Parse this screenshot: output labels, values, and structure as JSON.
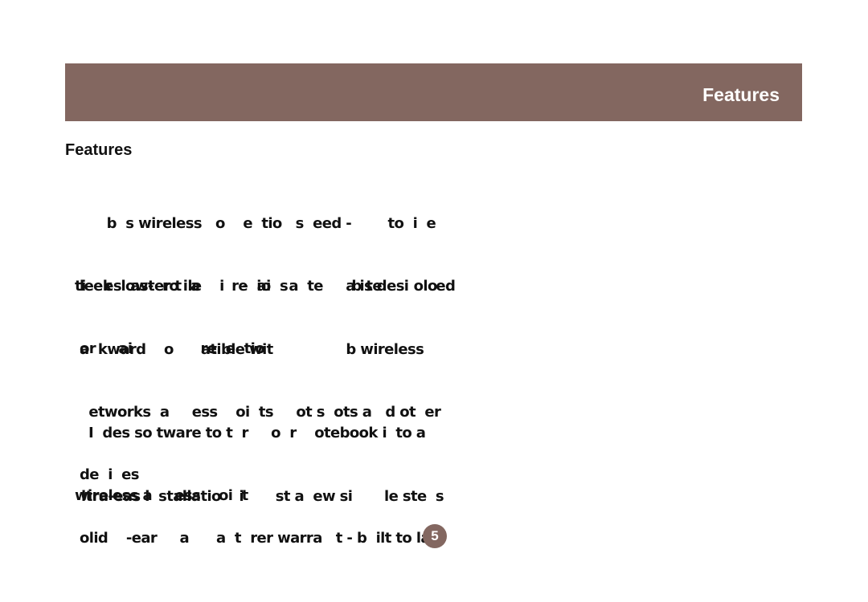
{
  "header": {
    "title": "Features",
    "band_color": "#836760"
  },
  "section": {
    "heading": "Features"
  },
  "features": [
    {
      "lines": [
        "       b  s wireless   o    e  tio   s  eed -        to  i  e",
        "ti    es  aster t  a       re  io  s              b te       olo"
      ]
    },
    {
      "lines": [
        "leek  low-  ro ile    i    -  ai    a  te     a is desi      ed",
        "or     ai               re  e  tio"
      ]
    },
    {
      "lines": [
        "a  kward    o      atible wit                b wireless",
        "  etworks  a     ess    oi  ts     ot s  ots a   d ot  er",
        "de  i  es"
      ]
    },
    {
      "lines": [
        "   I  des so tware to t  r     o  r    otebook i  to a",
        "wireless a     ess    oi  t"
      ]
    },
    {
      "lines": [
        "ltra-eas i  stallatio    i       st a  ew si       le ste  s"
      ]
    },
    {
      "lines": [
        "olid    -ear     a      a  t  rer warra   t - b  ilt to last"
      ]
    }
  ],
  "page": {
    "number": "5"
  }
}
